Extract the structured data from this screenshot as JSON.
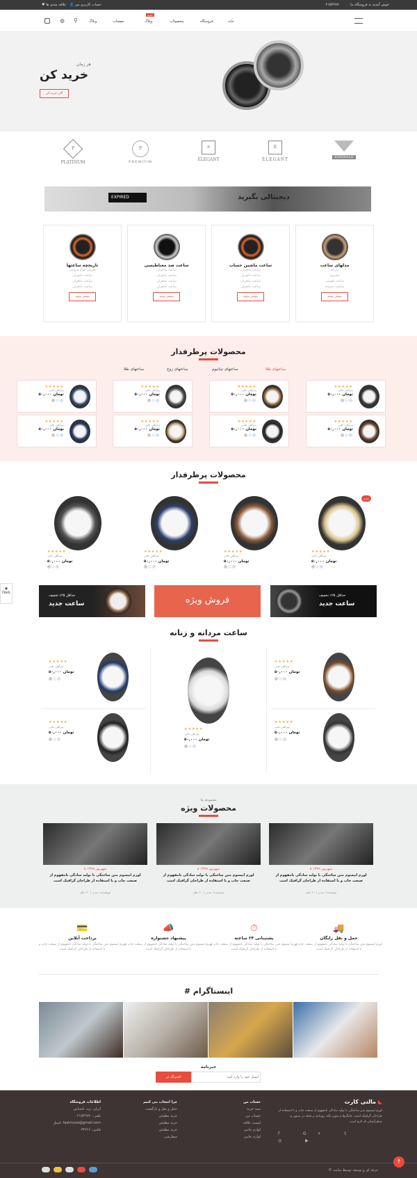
{
  "topbar": {
    "welcome": "خوش آمدید به فروشگاه ما",
    "phone": "۰۲۱۵۳۶۷۷۰",
    "account": "حساب کاربری من",
    "wishlist": "علاقه مندی ها"
  },
  "nav": {
    "items": [
      "خانه",
      "فروشگاه",
      "محصولات",
      "وبلاگ",
      "صفحات",
      "وبلاگ"
    ],
    "badge": "جدید"
  },
  "hero": {
    "subtitle": "هر زمان",
    "title": "خرید کن",
    "cta": "الان خرید کن"
  },
  "brands": [
    {
      "mark": "P",
      "name": "PLATINUM"
    },
    {
      "mark": "P",
      "name": "PREMIUM"
    },
    {
      "mark": "✕",
      "name": "ELEGANT"
    },
    {
      "mark": "E",
      "name": "ELEGANT"
    },
    {
      "mark": "✕",
      "name": "EMERALD"
    }
  ],
  "banner": {
    "expired": "EXPIRED",
    "text": "دیجیتالی بگیرید"
  },
  "category_cards": [
    {
      "title": "تاریخچه ساعتها",
      "items": [
        "معرفی انواع فروشی",
        "ساعت مانعرلی",
        "ساعت مانعرلی",
        "ساعت مانعرلی"
      ],
      "button": "بیشتر ببینید"
    },
    {
      "title": "ساعت ضد مغناطیسی",
      "items": [
        "ساعت مانعرلی",
        "ساعت مانعرلی",
        "ساعت مانعرلی",
        "ساعت مانعرلی"
      ],
      "button": "بیشتر ببینید"
    },
    {
      "title": "ساعت ماشین حساب",
      "items": [
        "ساعت مانعرلی",
        "ساعت مانعرلی",
        "ساعت مانعرلی",
        "ساعت مانعرلی"
      ],
      "button": "بیشتر ببینید"
    },
    {
      "title": "مدلهای ساعت",
      "items": [
        "مردانه",
        "مچرونه",
        "ساعت طوسی",
        "ساعت دخترانه"
      ],
      "button": "بیشتر ببینید"
    }
  ],
  "popular1": {
    "title": "محصولات پرطرفدار",
    "tabs": [
      "ساعتهای طلا",
      "ساعتهای تیتانیوم",
      "ساعتهای زوج",
      "ساعتهای طلا"
    ],
    "product": {
      "name": "پیراهن نخی",
      "price": "۵۰,۰۰۰ تومان",
      "stars": "★★★★★"
    }
  },
  "popular2": {
    "title": "محصولات پرطرفدار",
    "new_badge": "جدید",
    "old_price": "۷۰,۰۰۰",
    "price": "۵۰,۰۰۰ تومان",
    "name": "پیراهن نخی",
    "stars": "★★★★★"
  },
  "promos": [
    {
      "line1": "حداقل ۲۵٪ تخفیف",
      "line2": "ساعت جدید"
    },
    {
      "label": "فروش ویژه"
    },
    {
      "line1": "حداقل ۲۵٪ تخفیف",
      "line2": "ساعت جدید"
    }
  ],
  "side": {
    "icon_label": "Dark"
  },
  "mens_womens": {
    "title": "ساعت مردانه و زنانه",
    "price": "۵۰,۰۰۰ تومان",
    "old": "۷۰,۰۰۰",
    "name": "پیراهن نخی",
    "stars": "★★★★★"
  },
  "special": {
    "kicker": "مجموعه ما",
    "title": "محصولات ویژه",
    "posts": [
      {
        "date": "۸ شهریور ۱۳۹۹",
        "text": "لورم ایپسوم متن ساختگی با تولید سادگی نامفهوم از صنعت چاپ و با استفاده از طراحان گرافیک است",
        "author": "نویسنده: مدیر | ۲۰ نظر"
      },
      {
        "date": "۸ شهریور ۱۳۹۹",
        "text": "لورم ایپسوم متن ساختگی با تولید سادگی نامفهوم از صنعت چاپ و با استفاده از طراحان گرافیک است",
        "author": "نویسنده: مدیر | ۲۰ نظر"
      },
      {
        "date": "۸ شهریور ۱۳۹۹",
        "text": "لورم ایپسوم متن ساختگی با تولید سادگی نامفهوم از صنعت چاپ و با استفاده از طراحان گرافیک است",
        "author": "نویسنده: مدیر | ۲۰ نظر"
      }
    ]
  },
  "features": [
    {
      "title": "حمل و نقل رایگان",
      "text": "لورم ایپسوم متن ساختگی با تولید سادگی نامفهوم از صنعت چاپ و با استفاده از طراحان گرافیک است"
    },
    {
      "title": "پشتیبانی ۲۴ ساعته",
      "text": "لورم ایپسوم متن ساختگی با تولید سادگی نامفهوم از صنعت چاپ و با استفاده از طراحان گرافیک است"
    },
    {
      "title": "پیشنهاد جشنواره",
      "text": "لورم ایپسوم متن ساختگی با تولید سادگی نامفهوم از صنعت چاپ و با استفاده از طراحان گرافیک است"
    },
    {
      "title": "پرداخت آنلاین",
      "text": "لورم ایپسوم متن ساختگی با تولید سادگی نامفهوم از صنعت چاپ و با استفاده از طراحان گرافیک است"
    }
  ],
  "instagram": {
    "title": "# اینستاگرام"
  },
  "newsletter": {
    "title": "خبرنامه",
    "placeholder": "ایمیل خود را وارد کنید",
    "button": "اشتراک در"
  },
  "footer": {
    "brand": "مالتی کارت",
    "about": "لورم ایپسوم متن ساختگی با تولید سادگی نامفهوم از صنعت چاپ و با استفاده از طراحان گرافیک است. چاپگرها و متون بلکه روزنامه و مجله در ستون و سطرآنچنان که لازم است",
    "col1_title": "حساب من",
    "col1": [
      "سبد خرید",
      "حساب من",
      "لیست علاقه",
      "لوازم جانبی",
      "لوازم جانبی"
    ],
    "col2_title": "چرا انتخاب می کنیم",
    "col2": [
      "حمل و نقل و بازگشت",
      "خرید مطمئن",
      "خرید مطمئن",
      "خرید مطمئن",
      "سفارشی"
    ],
    "col3_title": "اطلاعات فروشگاه",
    "col3": [
      "ایران، یزد، ناشناس",
      "تلفن: ۰۲۱۵۳۶۷۷۰",
      "ایمیل: fastmuse@gmail.com",
      "فکس: ۰۳۴۲۶۶"
    ],
    "copyright": "© حرفه ای و توسعه توسط سایت"
  }
}
